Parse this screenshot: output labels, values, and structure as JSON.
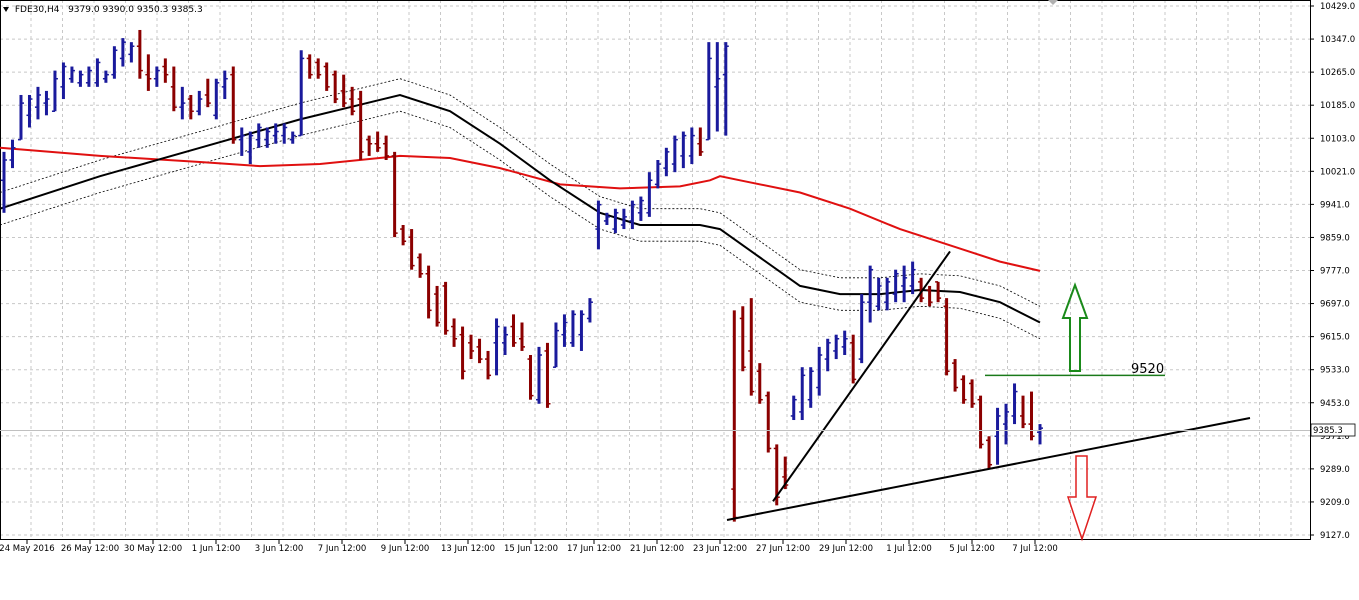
{
  "header": {
    "symbol": "FDE30,H4",
    "open": "9379.0",
    "high": "9390.0",
    "low": "9350.3",
    "close": "9385.3"
  },
  "chart_data": {
    "type": "ohlc-bar",
    "title": "FDE30,H4",
    "ylim": [
      9127,
      10429
    ],
    "y_ticks": [
      "10429.0",
      "10347.0",
      "10265.0",
      "10185.0",
      "10103.0",
      "10021.0",
      "9941.0",
      "9859.0",
      "9777.0",
      "9697.0",
      "9615.0",
      "9533.0",
      "9453.0",
      "9371.0",
      "9289.0",
      "9209.0",
      "9127.0"
    ],
    "x_ticks": [
      "24 May 2016",
      "26 May 12:00",
      "30 May 12:00",
      "1 Jun 12:00",
      "3 Jun 12:00",
      "7 Jun 12:00",
      "9 Jun 12:00",
      "13 Jun 12:00",
      "15 Jun 12:00",
      "17 Jun 12:00",
      "21 Jun 12:00",
      "23 Jun 12:00",
      "27 Jun 12:00",
      "29 Jun 12:00",
      "1 Jul 12:00",
      "5 Jul 12:00",
      "7 Jul 12:00"
    ],
    "current_price": "9385.3",
    "bull_color": "#1a1a9c",
    "bear_color": "#8b0000",
    "bars": [
      {
        "o": 10000,
        "h": 10070,
        "l": 9920,
        "c": 10050
      },
      {
        "o": 10050,
        "h": 10100,
        "l": 10030,
        "c": 10080
      },
      {
        "o": 10100,
        "h": 10210,
        "l": 10100,
        "c": 10190
      },
      {
        "o": 10160,
        "h": 10210,
        "l": 10130,
        "c": 10200
      },
      {
        "o": 10180,
        "h": 10230,
        "l": 10150,
        "c": 10210
      },
      {
        "o": 10190,
        "h": 10220,
        "l": 10160,
        "c": 10200
      },
      {
        "o": 10170,
        "h": 10270,
        "l": 10170,
        "c": 10250
      },
      {
        "o": 10230,
        "h": 10290,
        "l": 10200,
        "c": 10280
      },
      {
        "o": 10250,
        "h": 10280,
        "l": 10240,
        "c": 10270
      },
      {
        "o": 10240,
        "h": 10270,
        "l": 10230,
        "c": 10260
      },
      {
        "o": 10240,
        "h": 10280,
        "l": 10230,
        "c": 10270
      },
      {
        "o": 10240,
        "h": 10300,
        "l": 10230,
        "c": 10290
      },
      {
        "o": 10250,
        "h": 10270,
        "l": 10240,
        "c": 10260
      },
      {
        "o": 10260,
        "h": 10330,
        "l": 10250,
        "c": 10320
      },
      {
        "o": 10300,
        "h": 10350,
        "l": 10280,
        "c": 10340
      },
      {
        "o": 10310,
        "h": 10340,
        "l": 10290,
        "c": 10330
      },
      {
        "o": 10330,
        "h": 10370,
        "l": 10250,
        "c": 10270
      },
      {
        "o": 10260,
        "h": 10310,
        "l": 10220,
        "c": 10250
      },
      {
        "o": 10250,
        "h": 10280,
        "l": 10230,
        "c": 10270
      },
      {
        "o": 10280,
        "h": 10300,
        "l": 10240,
        "c": 10260
      },
      {
        "o": 10230,
        "h": 10280,
        "l": 10170,
        "c": 10180
      },
      {
        "o": 10180,
        "h": 10230,
        "l": 10150,
        "c": 10190
      },
      {
        "o": 10200,
        "h": 10210,
        "l": 10150,
        "c": 10170
      },
      {
        "o": 10170,
        "h": 10220,
        "l": 10160,
        "c": 10200
      },
      {
        "o": 10210,
        "h": 10250,
        "l": 10180,
        "c": 10190
      },
      {
        "o": 10160,
        "h": 10250,
        "l": 10150,
        "c": 10240
      },
      {
        "o": 10230,
        "h": 10270,
        "l": 10200,
        "c": 10250
      },
      {
        "o": 10260,
        "h": 10280,
        "l": 10090,
        "c": 10100
      },
      {
        "o": 10100,
        "h": 10130,
        "l": 10060,
        "c": 10110
      },
      {
        "o": 10070,
        "h": 10120,
        "l": 10040,
        "c": 10110
      },
      {
        "o": 10100,
        "h": 10140,
        "l": 10080,
        "c": 10130
      },
      {
        "o": 10100,
        "h": 10130,
        "l": 10080,
        "c": 10120
      },
      {
        "o": 10110,
        "h": 10140,
        "l": 10090,
        "c": 10120
      },
      {
        "o": 10110,
        "h": 10140,
        "l": 10090,
        "c": 10130
      },
      {
        "o": 10100,
        "h": 10120,
        "l": 10090,
        "c": 10110
      },
      {
        "o": 10110,
        "h": 10320,
        "l": 10110,
        "c": 10300
      },
      {
        "o": 10300,
        "h": 10310,
        "l": 10250,
        "c": 10260
      },
      {
        "o": 10290,
        "h": 10300,
        "l": 10250,
        "c": 10260
      },
      {
        "o": 10280,
        "h": 10290,
        "l": 10220,
        "c": 10230
      },
      {
        "o": 10260,
        "h": 10270,
        "l": 10190,
        "c": 10200
      },
      {
        "o": 10220,
        "h": 10260,
        "l": 10180,
        "c": 10190
      },
      {
        "o": 10200,
        "h": 10230,
        "l": 10160,
        "c": 10170
      },
      {
        "o": 10200,
        "h": 10220,
        "l": 10050,
        "c": 10070
      },
      {
        "o": 10100,
        "h": 10110,
        "l": 10060,
        "c": 10090
      },
      {
        "o": 10090,
        "h": 10120,
        "l": 10070,
        "c": 10080
      },
      {
        "o": 10090,
        "h": 10110,
        "l": 10050,
        "c": 10060
      },
      {
        "o": 10060,
        "h": 10070,
        "l": 9860,
        "c": 9870
      },
      {
        "o": 9880,
        "h": 9890,
        "l": 9840,
        "c": 9850
      },
      {
        "o": 9860,
        "h": 9880,
        "l": 9780,
        "c": 9790
      },
      {
        "o": 9810,
        "h": 9820,
        "l": 9760,
        "c": 9770
      },
      {
        "o": 9770,
        "h": 9790,
        "l": 9660,
        "c": 9680
      },
      {
        "o": 9720,
        "h": 9740,
        "l": 9640,
        "c": 9650
      },
      {
        "o": 9740,
        "h": 9750,
        "l": 9620,
        "c": 9630
      },
      {
        "o": 9640,
        "h": 9660,
        "l": 9590,
        "c": 9610
      },
      {
        "o": 9620,
        "h": 9640,
        "l": 9510,
        "c": 9530
      },
      {
        "o": 9600,
        "h": 9620,
        "l": 9560,
        "c": 9580
      },
      {
        "o": 9590,
        "h": 9610,
        "l": 9550,
        "c": 9560
      },
      {
        "o": 9560,
        "h": 9580,
        "l": 9510,
        "c": 9520
      },
      {
        "o": 9600,
        "h": 9660,
        "l": 9520,
        "c": 9640
      },
      {
        "o": 9600,
        "h": 9640,
        "l": 9570,
        "c": 9620
      },
      {
        "o": 9640,
        "h": 9670,
        "l": 9590,
        "c": 9600
      },
      {
        "o": 9610,
        "h": 9650,
        "l": 9580,
        "c": 9590
      },
      {
        "o": 9560,
        "h": 9570,
        "l": 9460,
        "c": 9470
      },
      {
        "o": 9460,
        "h": 9590,
        "l": 9450,
        "c": 9570
      },
      {
        "o": 9580,
        "h": 9600,
        "l": 9440,
        "c": 9450
      },
      {
        "o": 9540,
        "h": 9650,
        "l": 9540,
        "c": 9630
      },
      {
        "o": 9620,
        "h": 9670,
        "l": 9590,
        "c": 9650
      },
      {
        "o": 9600,
        "h": 9680,
        "l": 9590,
        "c": 9670
      },
      {
        "o": 9620,
        "h": 9680,
        "l": 9580,
        "c": 9670
      },
      {
        "o": 9660,
        "h": 9710,
        "l": 9650,
        "c": 9700
      },
      {
        "o": 9880,
        "h": 9950,
        "l": 9830,
        "c": 9940
      },
      {
        "o": 9900,
        "h": 9920,
        "l": 9890,
        "c": 9910
      },
      {
        "o": 9880,
        "h": 9930,
        "l": 9870,
        "c": 9920
      },
      {
        "o": 9890,
        "h": 9930,
        "l": 9880,
        "c": 9910
      },
      {
        "o": 9900,
        "h": 9950,
        "l": 9880,
        "c": 9940
      },
      {
        "o": 9920,
        "h": 9960,
        "l": 9900,
        "c": 9950
      },
      {
        "o": 9920,
        "h": 10020,
        "l": 9910,
        "c": 10000
      },
      {
        "o": 9990,
        "h": 10050,
        "l": 9980,
        "c": 10040
      },
      {
        "o": 10030,
        "h": 10080,
        "l": 10010,
        "c": 10070
      },
      {
        "o": 10040,
        "h": 10110,
        "l": 10020,
        "c": 10100
      },
      {
        "o": 10060,
        "h": 10120,
        "l": 10030,
        "c": 10110
      },
      {
        "o": 10060,
        "h": 10130,
        "l": 10040,
        "c": 10110
      },
      {
        "o": 10090,
        "h": 10130,
        "l": 10060,
        "c": 10070
      },
      {
        "o": 10100,
        "h": 10340,
        "l": 10100,
        "c": 10300
      },
      {
        "o": 10230,
        "h": 10340,
        "l": 10120,
        "c": 10250
      },
      {
        "o": 10260,
        "h": 10340,
        "l": 10110,
        "c": 10330
      },
      {
        "o": 9240,
        "h": 9680,
        "l": 9160,
        "c": 9170
      },
      {
        "o": 9660,
        "h": 9690,
        "l": 9530,
        "c": 9540
      },
      {
        "o": 9580,
        "h": 9710,
        "l": 9470,
        "c": 9480
      },
      {
        "o": 9530,
        "h": 9550,
        "l": 9450,
        "c": 9460
      },
      {
        "o": 9470,
        "h": 9480,
        "l": 9330,
        "c": 9340
      },
      {
        "o": 9340,
        "h": 9350,
        "l": 9200,
        "c": 9220
      },
      {
        "o": 9270,
        "h": 9320,
        "l": 9240,
        "c": 9250
      },
      {
        "o": 9420,
        "h": 9470,
        "l": 9410,
        "c": 9460
      },
      {
        "o": 9430,
        "h": 9540,
        "l": 9410,
        "c": 9520
      },
      {
        "o": 9460,
        "h": 9540,
        "l": 9440,
        "c": 9530
      },
      {
        "o": 9490,
        "h": 9590,
        "l": 9470,
        "c": 9570
      },
      {
        "o": 9560,
        "h": 9610,
        "l": 9530,
        "c": 9600
      },
      {
        "o": 9580,
        "h": 9620,
        "l": 9560,
        "c": 9610
      },
      {
        "o": 9590,
        "h": 9630,
        "l": 9570,
        "c": 9610
      },
      {
        "o": 9600,
        "h": 9620,
        "l": 9500,
        "c": 9510
      },
      {
        "o": 9560,
        "h": 9720,
        "l": 9550,
        "c": 9700
      },
      {
        "o": 9700,
        "h": 9790,
        "l": 9650,
        "c": 9780
      },
      {
        "o": 9690,
        "h": 9760,
        "l": 9680,
        "c": 9740
      },
      {
        "o": 9700,
        "h": 9760,
        "l": 9680,
        "c": 9750
      },
      {
        "o": 9720,
        "h": 9780,
        "l": 9700,
        "c": 9770
      },
      {
        "o": 9740,
        "h": 9790,
        "l": 9700,
        "c": 9760
      },
      {
        "o": 9740,
        "h": 9800,
        "l": 9720,
        "c": 9780
      },
      {
        "o": 9750,
        "h": 9760,
        "l": 9700,
        "c": 9710
      },
      {
        "o": 9730,
        "h": 9740,
        "l": 9690,
        "c": 9700
      },
      {
        "o": 9750,
        "h": 9750,
        "l": 9700,
        "c": 9710
      },
      {
        "o": 9690,
        "h": 9710,
        "l": 9520,
        "c": 9530
      },
      {
        "o": 9550,
        "h": 9560,
        "l": 9480,
        "c": 9490
      },
      {
        "o": 9510,
        "h": 9520,
        "l": 9450,
        "c": 9460
      },
      {
        "o": 9500,
        "h": 9510,
        "l": 9440,
        "c": 9450
      },
      {
        "o": 9460,
        "h": 9470,
        "l": 9340,
        "c": 9350
      },
      {
        "o": 9360,
        "h": 9370,
        "l": 9290,
        "c": 9300
      },
      {
        "o": 9370,
        "h": 9440,
        "l": 9300,
        "c": 9420
      },
      {
        "o": 9400,
        "h": 9450,
        "l": 9350,
        "c": 9430
      },
      {
        "o": 9420,
        "h": 9500,
        "l": 9400,
        "c": 9480
      },
      {
        "o": 9420,
        "h": 9470,
        "l": 9390,
        "c": 9400
      },
      {
        "o": 9400,
        "h": 9480,
        "l": 9360,
        "c": 9370
      },
      {
        "o": 9380,
        "h": 9400,
        "l": 9350,
        "c": 9390
      }
    ],
    "ma_black": [
      [
        0,
        9930
      ],
      [
        100,
        10010
      ],
      [
        200,
        10080
      ],
      [
        300,
        10150
      ],
      [
        350,
        10180
      ],
      [
        400,
        10210
      ],
      [
        450,
        10170
      ],
      [
        500,
        10090
      ],
      [
        550,
        10000
      ],
      [
        600,
        9920
      ],
      [
        640,
        9890
      ],
      [
        700,
        9890
      ],
      [
        720,
        9880
      ],
      [
        760,
        9810
      ],
      [
        800,
        9740
      ],
      [
        840,
        9720
      ],
      [
        880,
        9720
      ],
      [
        920,
        9730
      ],
      [
        960,
        9725
      ],
      [
        1000,
        9700
      ],
      [
        1040,
        9650
      ]
    ],
    "ma_upper": [
      [
        0,
        9970
      ],
      [
        100,
        10050
      ],
      [
        200,
        10120
      ],
      [
        300,
        10190
      ],
      [
        350,
        10220
      ],
      [
        400,
        10250
      ],
      [
        450,
        10210
      ],
      [
        500,
        10130
      ],
      [
        550,
        10040
      ],
      [
        600,
        9960
      ],
      [
        640,
        9930
      ],
      [
        700,
        9930
      ],
      [
        720,
        9920
      ],
      [
        760,
        9850
      ],
      [
        800,
        9780
      ],
      [
        840,
        9760
      ],
      [
        880,
        9760
      ],
      [
        920,
        9770
      ],
      [
        960,
        9765
      ],
      [
        1000,
        9740
      ],
      [
        1040,
        9690
      ]
    ],
    "ma_lower": [
      [
        0,
        9890
      ],
      [
        100,
        9970
      ],
      [
        200,
        10040
      ],
      [
        300,
        10110
      ],
      [
        350,
        10140
      ],
      [
        400,
        10170
      ],
      [
        450,
        10130
      ],
      [
        500,
        10050
      ],
      [
        550,
        9960
      ],
      [
        600,
        9880
      ],
      [
        640,
        9850
      ],
      [
        700,
        9850
      ],
      [
        720,
        9840
      ],
      [
        760,
        9770
      ],
      [
        800,
        9700
      ],
      [
        840,
        9680
      ],
      [
        880,
        9680
      ],
      [
        920,
        9690
      ],
      [
        960,
        9685
      ],
      [
        1000,
        9660
      ],
      [
        1040,
        9610
      ]
    ],
    "ma_red": [
      [
        0,
        10080
      ],
      [
        100,
        10060
      ],
      [
        200,
        10045
      ],
      [
        260,
        10035
      ],
      [
        320,
        10040
      ],
      [
        400,
        10060
      ],
      [
        450,
        10055
      ],
      [
        500,
        10030
      ],
      [
        560,
        9990
      ],
      [
        620,
        9980
      ],
      [
        680,
        9985
      ],
      [
        710,
        10000
      ],
      [
        720,
        10010
      ],
      [
        740,
        10000
      ],
      [
        800,
        9970
      ],
      [
        850,
        9930
      ],
      [
        900,
        9880
      ],
      [
        950,
        9840
      ],
      [
        1000,
        9800
      ],
      [
        1040,
        9777
      ]
    ],
    "trendlines": [
      {
        "from": [
          727,
          9164
        ],
        "to": [
          1250,
          9415
        ],
        "color": "#000000"
      },
      {
        "from": [
          773,
          9210
        ],
        "to": [
          950,
          9825
        ],
        "color": "#000000"
      }
    ],
    "level_label": "9520",
    "level": {
      "from_x": 985,
      "to_x": 1165,
      "price": 9520,
      "color": "#1a7a1a"
    },
    "up_arrow_color": "#1a8a1a",
    "down_arrow_color": "#e02020"
  }
}
